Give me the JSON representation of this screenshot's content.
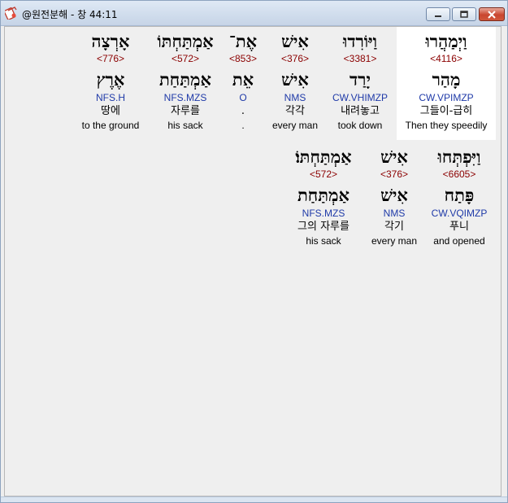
{
  "window": {
    "title": "@원전분해 - 창 44:11"
  },
  "words": [
    {
      "id": "w1",
      "hebrew": "וַיְמַהֲרוּ",
      "strong": "<4116>",
      "lemma": "מָהַר",
      "parsing": "CW.VPIMZP",
      "korean": "그들이-급히",
      "english": "Then they speedily",
      "selected": true
    },
    {
      "id": "w2",
      "hebrew": "וַיּוֹרִדוּ",
      "strong": "<3381>",
      "lemma": "יָרַד",
      "parsing": "CW.VHIMZP",
      "korean": "내려놓고",
      "english": "took down",
      "selected": false
    },
    {
      "id": "w3",
      "hebrew": "אִישׁ",
      "strong": "<376>",
      "lemma": "אִישׁ",
      "parsing": "NMS",
      "korean": "각각",
      "english": "every man",
      "selected": false
    },
    {
      "id": "w4",
      "hebrew": "אֶת־",
      "strong": "<853>",
      "lemma": "אֵת",
      "parsing": "O",
      "korean": ".",
      "english": ".",
      "selected": false
    },
    {
      "id": "w5",
      "hebrew": "אַמְתַּחְתּוֹ",
      "strong": "<572>",
      "lemma": "אַמְתַּחַת",
      "parsing": "NFS.MZS",
      "korean": "자루를",
      "english": "his sack",
      "selected": false
    },
    {
      "id": "w6",
      "hebrew": "אָרְצָה",
      "strong": "<776>",
      "lemma": "אֶרֶץ",
      "parsing": "NFS.H",
      "korean": "땅에",
      "english": "to the ground",
      "selected": false
    },
    {
      "id": "w7",
      "hebrew": "וַיִּפְתְּחוּ",
      "strong": "<6605>",
      "lemma": "פָּתַח",
      "parsing": "CW.VQIMZP",
      "korean": "푸니",
      "english": "and opened",
      "selected": false
    },
    {
      "id": "w8",
      "hebrew": "אִישׁ",
      "strong": "<376>",
      "lemma": "אִישׁ",
      "parsing": "NMS",
      "korean": "각기",
      "english": "every man",
      "selected": false
    },
    {
      "id": "w9",
      "hebrew": "אַמְתַּחְתּוֹ׃",
      "strong": "<572>",
      "lemma": "אַמְתַּחַת",
      "parsing": "NFS.MZS",
      "korean": "그의 자루를",
      "english": "his sack",
      "selected": false
    }
  ]
}
